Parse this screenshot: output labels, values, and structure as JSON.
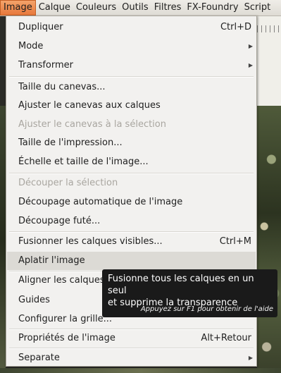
{
  "menubar": {
    "items": [
      {
        "label": "Image"
      },
      {
        "label": "Calque"
      },
      {
        "label": "Couleurs"
      },
      {
        "label": "Outils"
      },
      {
        "label": "Filtres"
      },
      {
        "label": "FX-Foundry"
      },
      {
        "label": "Script"
      }
    ]
  },
  "menu": {
    "items": {
      "dupliquer": {
        "label": "Dupliquer",
        "accel": "Ctrl+D"
      },
      "mode": {
        "label": "Mode"
      },
      "transformer": {
        "label": "Transformer"
      },
      "taille_canevas": {
        "label": "Taille du canevas..."
      },
      "ajuster_calques": {
        "label": "Ajuster le canevas aux calques"
      },
      "ajuster_selection": {
        "label": "Ajuster le canevas à la sélection"
      },
      "taille_impression": {
        "label": "Taille de l'impression..."
      },
      "echelle": {
        "label": "Échelle et taille de l'image..."
      },
      "decouper_selection": {
        "label": "Découper la sélection"
      },
      "decoupage_auto": {
        "label": "Découpage automatique de l'image"
      },
      "decoupage_fute": {
        "label": "Découpage futé..."
      },
      "fusionner": {
        "label": "Fusionner les calques visibles...",
        "accel": "Ctrl+M"
      },
      "aplatir": {
        "label": "Aplatir l'image"
      },
      "aligner": {
        "label": "Aligner les calques"
      },
      "guides": {
        "label": "Guides"
      },
      "grille": {
        "label": "Configurer la grille..."
      },
      "proprietes": {
        "label": "Propriétés de l'image",
        "accel": "Alt+Retour"
      },
      "separate": {
        "label": "Separate"
      }
    }
  },
  "tooltip": {
    "line1": "Fusionne tous les calques en un seul",
    "line2": "et supprime la transparence",
    "hint": "Appuyez sur F1 pour obtenir de l'aide"
  },
  "colors": {
    "menubar_active": "#e8793c",
    "menu_bg": "#f2f1ef",
    "hover": "#dcdad5",
    "disabled_text": "#a9a6a0",
    "tooltip_bg": "#1a1a1a"
  },
  "icons": {
    "submenu_arrow": "chevron-right-icon"
  }
}
